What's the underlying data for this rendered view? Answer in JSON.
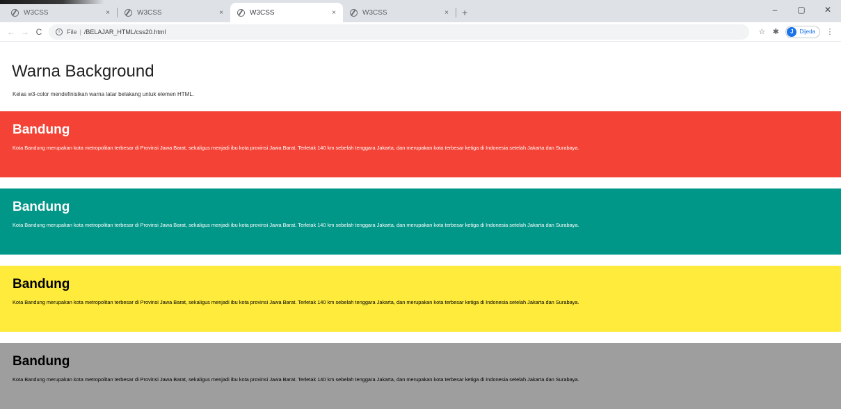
{
  "browser": {
    "tabs": [
      {
        "title": "W3CSS",
        "close": "×"
      },
      {
        "title": "W3CSS",
        "close": "×"
      },
      {
        "title": "W3CSS",
        "close": "×"
      },
      {
        "title": "W3CSS",
        "close": "×"
      }
    ],
    "new_tab": "+",
    "window_controls": {
      "minimize": "–",
      "maximize": "▢",
      "close": "✕"
    },
    "nav": {
      "back": "←",
      "forward": "→",
      "reload": "C"
    },
    "omnibox": {
      "info": "i",
      "scheme": "File",
      "separator": "|",
      "path": "/BELAJAR_HTML/css20.html"
    },
    "toolbar_icons": {
      "star": "☆",
      "extensions": "✱",
      "menu": "⋮"
    },
    "profile": {
      "initial": "J",
      "label": "Dijeda"
    }
  },
  "page": {
    "title": "Warna Background",
    "description": "Kelas w3-color mendefinisikan warna latar belakang untuk elemen HTML."
  },
  "panels": [
    {
      "color": "#f44336",
      "title": "Bandung",
      "text": "Kota Bandung merupakan kota metropolitan terbesar di Provinsi Jawa Barat, sekaligus menjadi ibu kota provinsi Jawa Barat. Terletak 140 km sebelah tenggara Jakarta, dan merupakan kota terbesar ketiga di Indonesia setelah Jakarta dan Surabaya."
    },
    {
      "color": "#009688",
      "title": "Bandung",
      "text": "Kota Bandung merupakan kota metropolitan terbesar di Provinsi Jawa Barat, sekaligus menjadi ibu kota provinsi Jawa Barat. Terletak 140 km sebelah tenggara Jakarta, dan merupakan kota terbesar ketiga di Indonesia setelah Jakarta dan Surabaya."
    },
    {
      "color": "#ffeb3b",
      "title": "Bandung",
      "text": "Kota Bandung merupakan kota metropolitan terbesar di Provinsi Jawa Barat, sekaligus menjadi ibu kota provinsi Jawa Barat. Terletak 140 km sebelah tenggara Jakarta, dan merupakan kota terbesar ketiga di Indonesia setelah Jakarta dan Surabaya."
    },
    {
      "color": "#9e9e9e",
      "title": "Bandung",
      "text": "Kota Bandung merupakan kota metropolitan terbesar di Provinsi Jawa Barat, sekaligus menjadi ibu kota provinsi Jawa Barat. Terletak 140 km sebelah tenggara Jakarta, dan merupakan kota terbesar ketiga di Indonesia setelah Jakarta dan Surabaya."
    }
  ]
}
